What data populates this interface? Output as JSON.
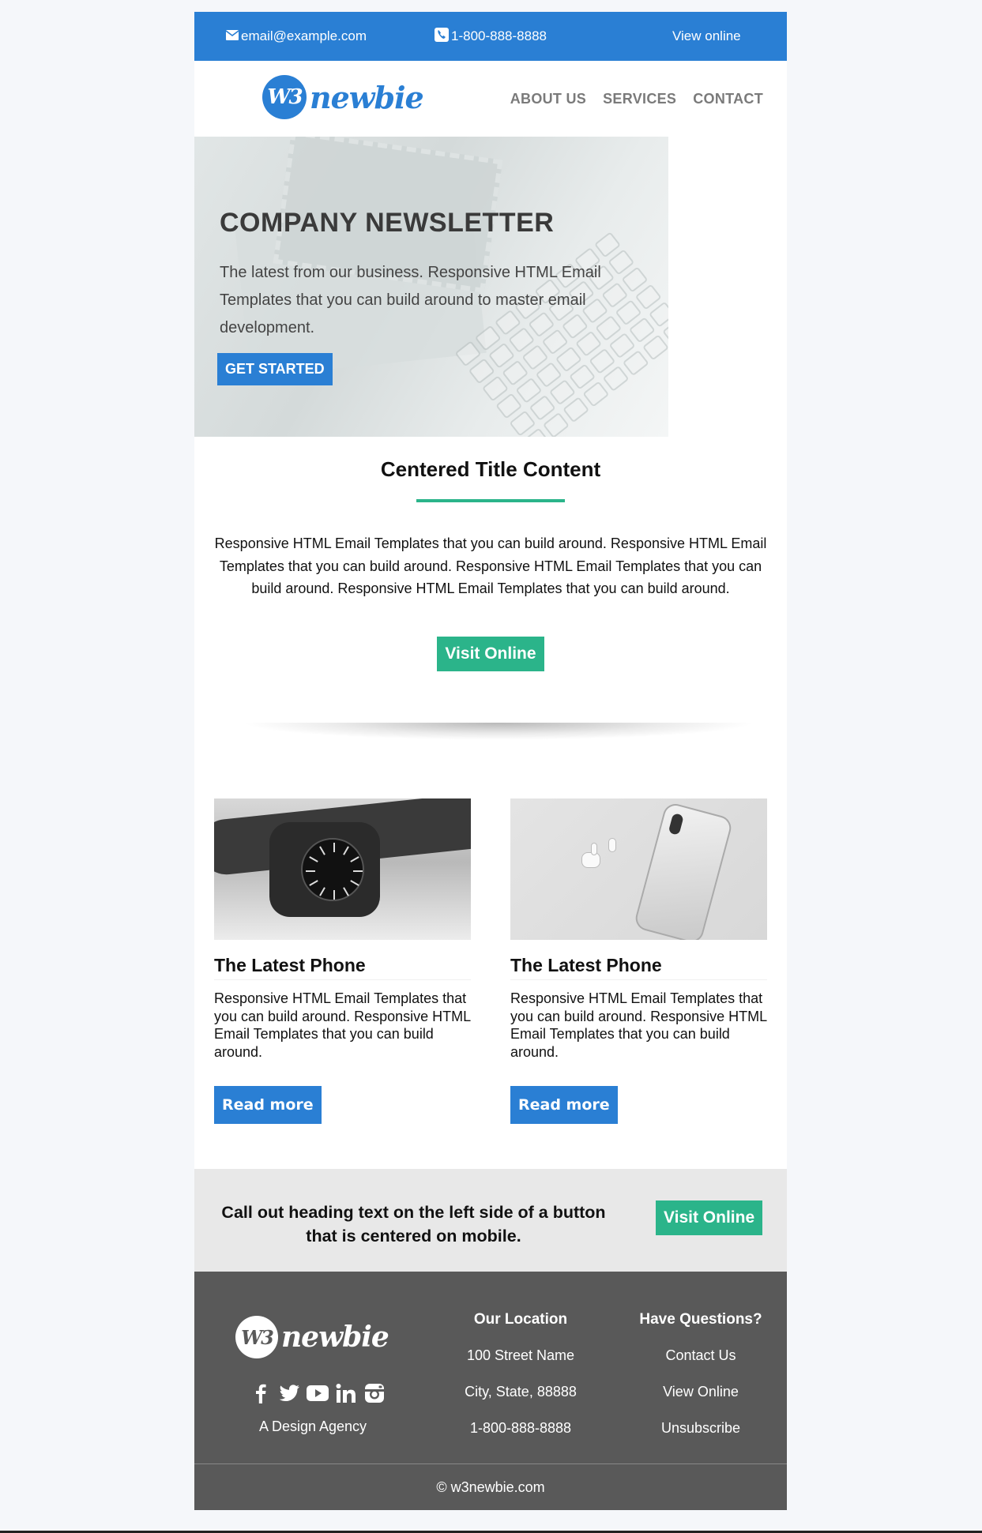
{
  "topbar": {
    "email": "email@example.com",
    "phone": "1-800-888-8888",
    "view_online": "View online"
  },
  "header": {
    "logo_mark": "W3",
    "logo_word": "newbie",
    "nav": [
      "ABOUT US",
      "SERVICES",
      "CONTACT"
    ]
  },
  "hero": {
    "title": "COMPANY NEWSLETTER",
    "body": "The latest from our business. Responsive HTML Email Templates that you can build around to master email development.",
    "cta": "GET STARTED"
  },
  "centered": {
    "title": "Centered Title Content",
    "body": "Responsive HTML Email Templates that you can build around. Responsive HTML Email Templates that you can build around. Responsive HTML Email Templates that you can build around. Responsive HTML Email Templates that you can build around.",
    "cta": "Visit Online"
  },
  "products": [
    {
      "image": "smartwatch-photo",
      "title": "The Latest Phone",
      "body": "Responsive HTML Email Templates that you can build around. Responsive HTML Email Templates that you can build around.",
      "cta": "Read more"
    },
    {
      "image": "iphone-airpods-photo",
      "title": "The Latest Phone",
      "body": "Responsive HTML Email Templates that you can build around. Responsive HTML Email Templates that you can build around.",
      "cta": "Read more"
    }
  ],
  "callout": {
    "text": "Call out heading text on the left side of a button that is centered on mobile.",
    "cta": "Visit Online"
  },
  "footer": {
    "logo_mark": "W3",
    "logo_word": "newbie",
    "social_icons": [
      "facebook-icon",
      "twitter-icon",
      "youtube-icon",
      "linkedin-icon",
      "instagram-icon"
    ],
    "tagline": "A Design Agency",
    "location": {
      "heading": "Our Location",
      "lines": [
        "100 Street Name",
        "City, State, 88888",
        "1-800-888-8888"
      ]
    },
    "questions": {
      "heading": "Have Questions?",
      "links": [
        "Contact Us",
        "View Online",
        "Unsubscribe"
      ]
    },
    "copyright": "© w3newbie.com"
  },
  "colors": {
    "brand_blue": "#2a7fd4",
    "accent_green": "#2bb48a",
    "footer_gray": "#595959",
    "callout_gray": "#e8e8e8",
    "page_bg": "#f5f7fa"
  }
}
